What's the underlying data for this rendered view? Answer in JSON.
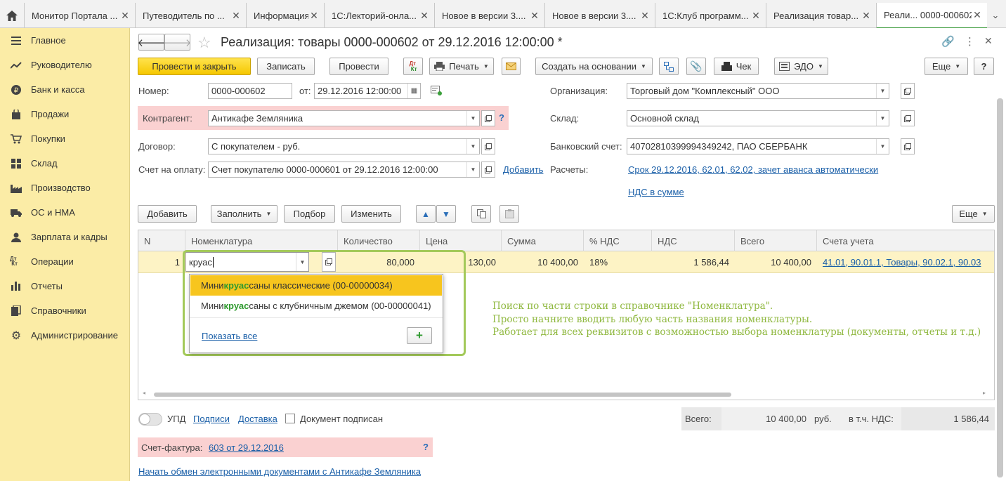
{
  "tabs": [
    {
      "label": "Монитор Портала ..."
    },
    {
      "label": "Путеводитель по ..."
    },
    {
      "label": "Информация"
    },
    {
      "label": "1С:Лекторий-онла..."
    },
    {
      "label": "Новое в версии 3...."
    },
    {
      "label": "Новое в версии 3...."
    },
    {
      "label": "1С:Клуб программ..."
    },
    {
      "label": "Реализация товар..."
    },
    {
      "label": "Реали... 0000-000602"
    }
  ],
  "sidebar": {
    "items": [
      {
        "label": "Главное",
        "icon": "menu-icon"
      },
      {
        "label": "Руководителю",
        "icon": "trend-icon"
      },
      {
        "label": "Банк и касса",
        "icon": "coin-icon"
      },
      {
        "label": "Продажи",
        "icon": "bag-icon"
      },
      {
        "label": "Покупки",
        "icon": "cart-icon"
      },
      {
        "label": "Склад",
        "icon": "grid-icon"
      },
      {
        "label": "Производство",
        "icon": "factory-icon"
      },
      {
        "label": "ОС и НМА",
        "icon": "truck-icon"
      },
      {
        "label": "Зарплата и кадры",
        "icon": "people-icon"
      },
      {
        "label": "Операции",
        "icon": "dt-kt-icon"
      },
      {
        "label": "Отчеты",
        "icon": "bars-icon"
      },
      {
        "label": "Справочники",
        "icon": "books-icon"
      },
      {
        "label": "Администрирование",
        "icon": "gear-icon"
      }
    ]
  },
  "doc": {
    "title": "Реализация: товары 0000-000602 от 29.12.2016 12:00:00 *"
  },
  "toolbar": {
    "post_close": "Провести и закрыть",
    "save": "Записать",
    "post": "Провести",
    "print": "Печать",
    "create_based": "Создать на основании",
    "check": "Чек",
    "edo": "ЭДО",
    "more": "Еще",
    "help": "?"
  },
  "form": {
    "number_label": "Номер:",
    "number_value": "0000-000602",
    "date_label": "от:",
    "date_value": "29.12.2016 12:00:00",
    "counterparty_label": "Контрагент:",
    "counterparty_value": "Антикафе Земляника",
    "contract_label": "Договор:",
    "contract_value": "С покупателем - руб.",
    "invoice_label": "Счет на оплату:",
    "invoice_value": "Счет покупателю 0000-000601 от 29.12.2016 12:00:00",
    "add_link": "Добавить",
    "org_label": "Организация:",
    "org_value": "Торговый дом \"Комплексный\" ООО",
    "warehouse_label": "Склад:",
    "warehouse_value": "Основной склад",
    "bank_label": "Банковский счет:",
    "bank_value": "40702810399994349242, ПАО СБЕРБАНК",
    "settlements_label": "Расчеты:",
    "settlements_link": "Срок 29.12.2016, 62.01, 62.02, зачет аванса автоматически",
    "vat_link": "НДС в сумме"
  },
  "table_toolbar": {
    "add": "Добавить",
    "fill": "Заполнить",
    "select": "Подбор",
    "change": "Изменить",
    "more": "Еще"
  },
  "table": {
    "columns": [
      "N",
      "Номенклатура",
      "Количество",
      "Цена",
      "Сумма",
      "% НДС",
      "НДС",
      "Всего",
      "Счета учета"
    ],
    "row": {
      "n": "1",
      "item_input": "круас",
      "qty": "80,000",
      "price": "130,00",
      "sum": "10 400,00",
      "vat_rate": "18%",
      "vat": "1 586,44",
      "total": "10 400,00",
      "accounts": "41.01, 90.01.1, Товары, 90.02.1, 90.03"
    }
  },
  "dropdown": {
    "items": [
      {
        "pre": "Мини",
        "hl": "круас",
        "post": "саны классические (00-00000034)"
      },
      {
        "pre": "Мини",
        "hl": "круас",
        "post": "саны с клубничным джемом (00-00000041)"
      }
    ],
    "show_all": "Показать все"
  },
  "hint": {
    "line1": "Поиск по части строки в справочнике \"Номенклатура\".",
    "line2": "Просто начните вводить любую часть названия номенклатуры.",
    "line3": "Работает для всех реквизитов с возможностью выбора номенклатуры (документы, отчеты и т.д.)"
  },
  "footer": {
    "upd": "УПД",
    "signatures": "Подписи",
    "delivery": "Доставка",
    "signed": "Документ подписан",
    "total_label": "Всего:",
    "total_value": "10 400,00",
    "currency": "руб.",
    "vat_label": "в т.ч. НДС:",
    "vat_value": "1 586,44",
    "invoice_label": "Счет-фактура:",
    "invoice_link": "603 от 29.12.2016",
    "invoice_help": "?",
    "exchange_link": "Начать обмен электронными документами с Антикафе Земляника"
  }
}
